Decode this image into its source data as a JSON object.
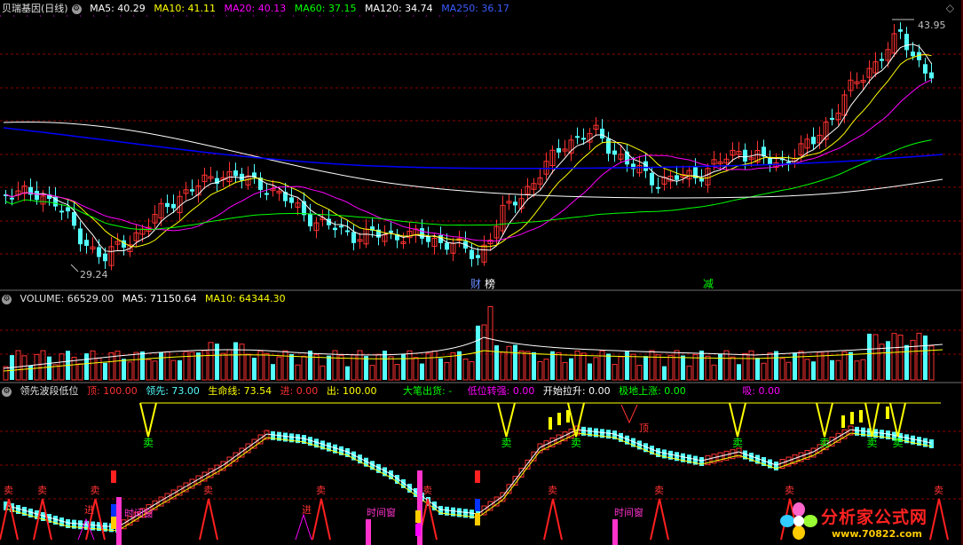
{
  "colors": {
    "up": "#ff3232",
    "down": "#54ffff",
    "ma5": "#ffffff",
    "ma10": "#ffff00",
    "ma20": "#ff00ff",
    "ma60": "#00ff00",
    "ma120": "#ffffff",
    "ma250": "#0000ff",
    "grid": "#8b0000"
  },
  "price_header": {
    "stock": "贝瑞基因(日线)",
    "ma5": "MA5: 40.29",
    "ma10": "MA10: 41.11",
    "ma20": "MA20: 40.13",
    "ma60": "MA60: 37.15",
    "ma120": "MA120: 34.74",
    "ma250": "MA250: 36.17"
  },
  "price_annotations": {
    "high": "43.95",
    "low": "29.24",
    "tag1": "财",
    "tag2": "榜",
    "tag3": "减"
  },
  "volume_header": {
    "volume": "VOLUME: 66529.00",
    "ma5": "MA5: 71150.64",
    "ma10": "MA10: 64344.30"
  },
  "indicator_header": {
    "name": "领先波段低位",
    "ding": "顶: 100.00",
    "lingxian": "领先: 73.00",
    "shengming": "生命线: 73.54",
    "jin": "进: 0.00",
    "chu": "出: 100.00",
    "dabi": "大笔出货: -",
    "diwei": "低位转强: 0.00",
    "kaishi": "开始拉升: 0.00",
    "jidi": "极地上涨: 0.00",
    "xi": "吸: 0.00"
  },
  "indicator_labels": {
    "sell": "卖",
    "window": "时间窗",
    "top": "顶",
    "enter": "进"
  },
  "logo": {
    "text": "分析家公式网",
    "url": "www.70822.com"
  }
}
